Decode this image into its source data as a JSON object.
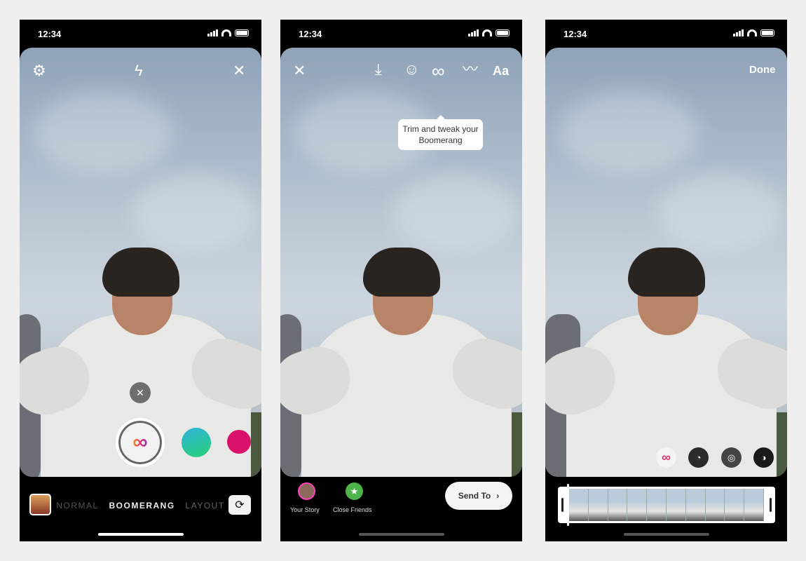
{
  "status": {
    "time": "12:34"
  },
  "screen1": {
    "icons": [
      "settings-icon",
      "flash-off-icon",
      "close-icon"
    ],
    "modes": [
      "NORMAL",
      "BOOMERANG",
      "LAYOUT"
    ],
    "active_mode": "BOOMERANG",
    "flash_off": "×"
  },
  "screen2": {
    "tooltip": "Trim and tweak your Boomerang",
    "text_tool": "Aa",
    "share": [
      {
        "label": "Your Story"
      },
      {
        "label": "Close Friends"
      }
    ],
    "send_to": "Send To"
  },
  "screen3": {
    "done": "Done",
    "effects": [
      "boomerang",
      "slowmo",
      "echo",
      "duo"
    ]
  },
  "colors": {
    "close_friends": "#4db34a",
    "bg": "#efefef"
  }
}
